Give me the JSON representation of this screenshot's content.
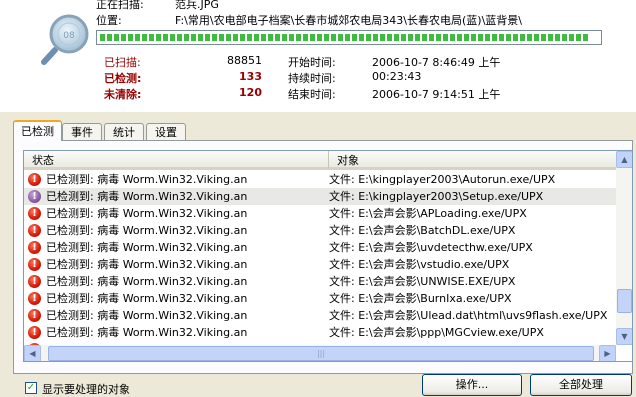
{
  "scan": {
    "scanning_label": "正在扫描:",
    "scanning_file": "范兵.JPG",
    "location_label": "位置:",
    "location_path": "F:\\常用\\农电部电子档案\\长春市城郊农电局343\\长春农电局(蓝)\\蓝背景\\",
    "progress": 0.98,
    "icon": "magnifier-scan-icon"
  },
  "stats": {
    "scanned_label": "已扫描:",
    "scanned_value": "88851",
    "detected_label": "已检测:",
    "detected_value": "133",
    "uncleaned_label": "未清除:",
    "uncleaned_value": "120",
    "start_label": "开始时间:",
    "start_value": "2006-10-7 8:46:49 上午",
    "duration_label": "持续时间:",
    "duration_value": "00:23:43",
    "end_label": "结束时间:",
    "end_value": "2006-10-7 9:14:51 上午"
  },
  "tabs": [
    {
      "label": "已检测"
    },
    {
      "label": "事件"
    },
    {
      "label": "统计"
    },
    {
      "label": "设置"
    }
  ],
  "list": {
    "col_status": "状态",
    "col_object": "对象",
    "rows": [
      {
        "status": "已检测到: 病毒 Worm.Win32.Viking.an",
        "object": "文件: E:\\kingplayer2003\\Autorun.exe/UPX"
      },
      {
        "status": "已检测到: 病毒 Worm.Win32.Viking.an",
        "object": "文件: E:\\kingplayer2003\\Setup.exe/UPX"
      },
      {
        "status": "已检测到: 病毒 Worm.Win32.Viking.an",
        "object": "文件: E:\\会声会影\\APLoading.exe/UPX"
      },
      {
        "status": "已检测到: 病毒 Worm.Win32.Viking.an",
        "object": "文件: E:\\会声会影\\BatchDL.exe/UPX"
      },
      {
        "status": "已检测到: 病毒 Worm.Win32.Viking.an",
        "object": "文件: E:\\会声会影\\uvdetecthw.exe/UPX"
      },
      {
        "status": "已检测到: 病毒 Worm.Win32.Viking.an",
        "object": "文件: E:\\会声会影\\vstudio.exe/UPX"
      },
      {
        "status": "已检测到: 病毒 Worm.Win32.Viking.an",
        "object": "文件: E:\\会声会影\\UNWISE.EXE/UPX"
      },
      {
        "status": "已检测到: 病毒 Worm.Win32.Viking.an",
        "object": "文件: E:\\会声会影\\BurnIxa.exe/UPX"
      },
      {
        "status": "已检测到: 病毒 Worm.Win32.Viking.an",
        "object": "文件: E:\\会声会影\\Ulead.dat\\html\\uvs9flash.exe/UPX"
      },
      {
        "status": "已检测到: 病毒 Worm.Win32.Viking.an",
        "object": "文件: E:\\会声会影\\ppp\\MGCview.exe/UPX"
      }
    ]
  },
  "footer": {
    "show_pending_label": "显示要处理的对象",
    "show_pending_checked": true,
    "actions_button": "操作...",
    "process_all_button": "全部处理"
  },
  "colors": {
    "alert_red": "#990000",
    "progress_green": "#3fbb3f",
    "tab_accent": "#f4a61d"
  }
}
